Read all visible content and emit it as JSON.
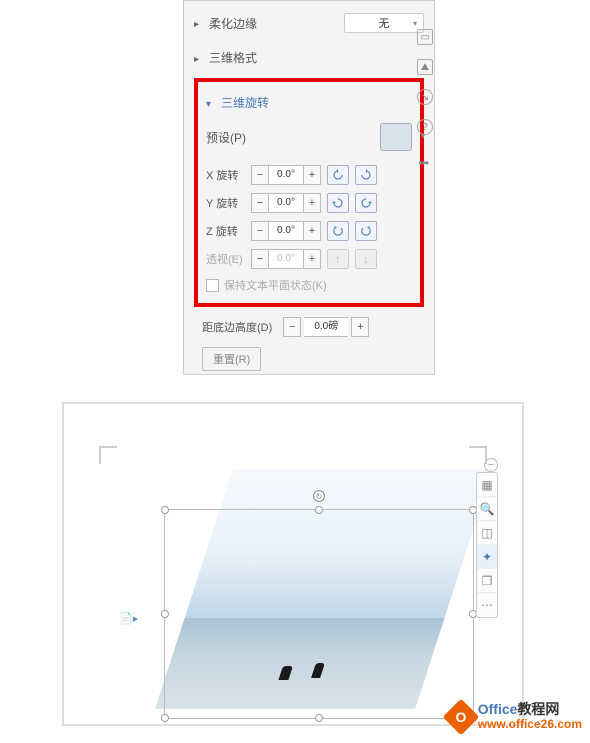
{
  "panel": {
    "soft_edges_label": "柔化边缘",
    "soft_edges_value": "无",
    "format_3d_label": "三维格式",
    "rotation_3d_label": "三维旋转",
    "preset_label": "预设(P)",
    "rows": {
      "x": {
        "label": "X 旋转",
        "value": "0.0°"
      },
      "y": {
        "label": "Y 旋转",
        "value": "0.0°"
      },
      "z": {
        "label": "Z 旋转",
        "value": "0.0°"
      },
      "perspective": {
        "label": "透视(E)",
        "value": "0.0°"
      }
    },
    "keep_flat_label": "保持文本平面状态(K)",
    "distance_label": "距底边高度(D)",
    "distance_value": "0.0磅",
    "reset_label": "重置(R)",
    "minus": "−",
    "plus": "+",
    "menu_dots": "•••"
  },
  "side_icons": {
    "i1": "clipboard-icon",
    "i2": "picture-icon",
    "i3": "arrow-icon",
    "i4": "help-icon"
  },
  "toolbar": {
    "items": [
      "fill-icon",
      "search-icon",
      "crop-icon",
      "effects-icon",
      "layer-icon",
      "more-icon"
    ]
  },
  "watermark": {
    "brand1": "Office",
    "brand2": "教程网",
    "url": "www.office26.com"
  }
}
